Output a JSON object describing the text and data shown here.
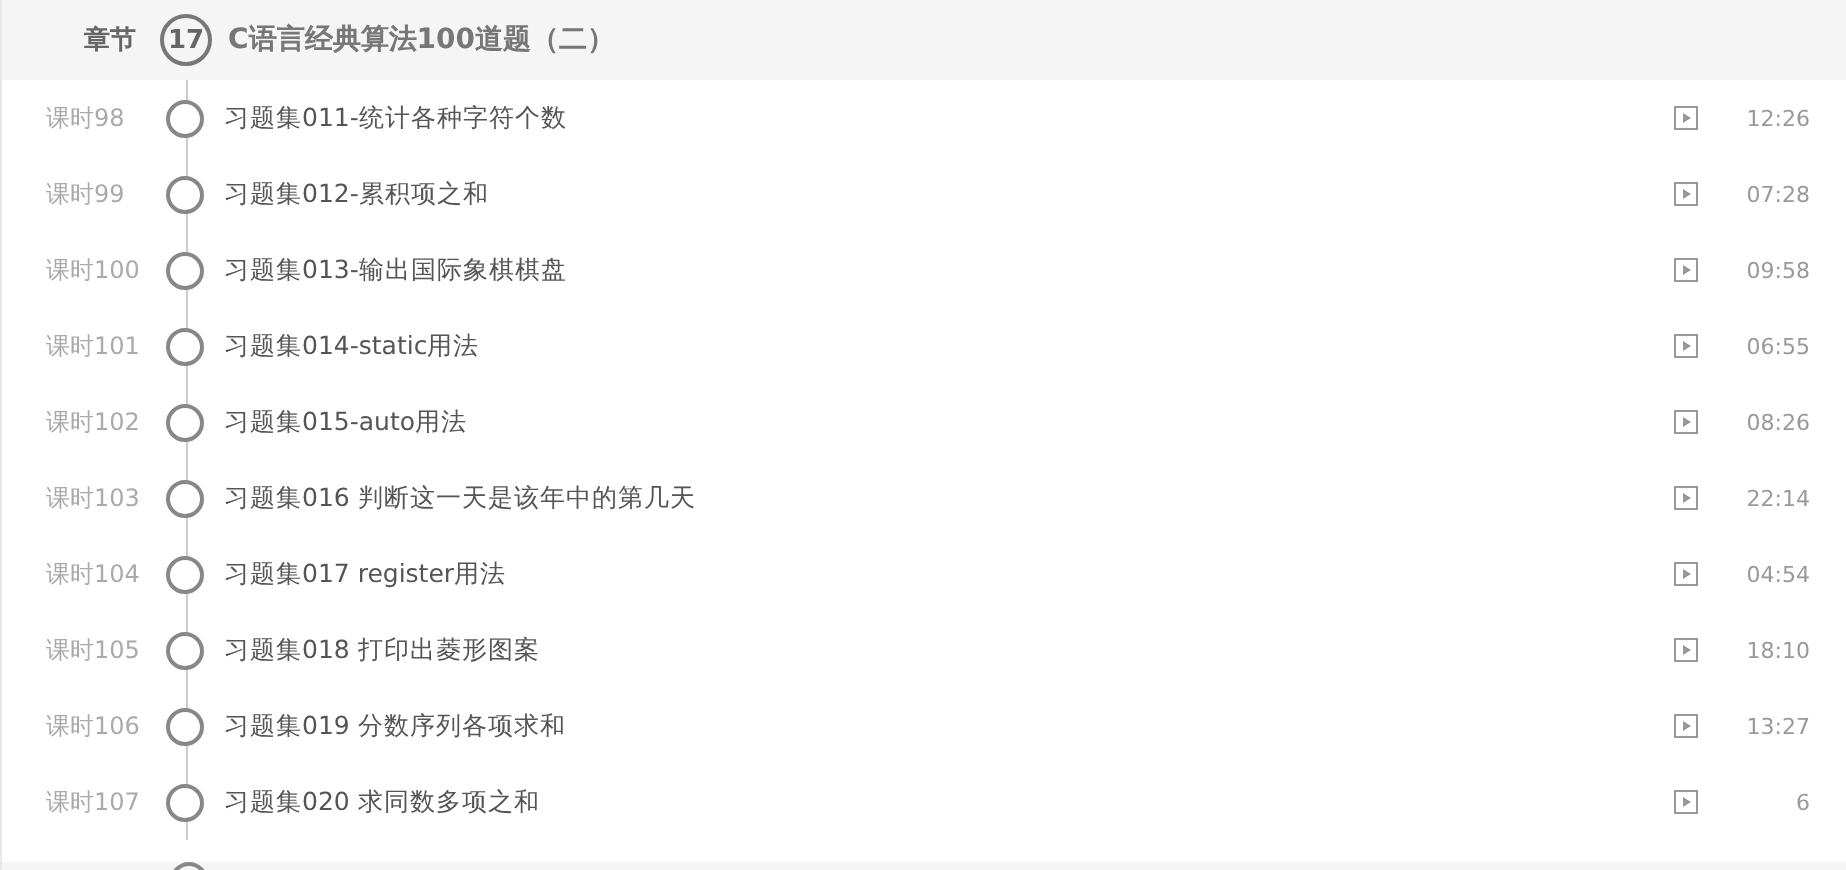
{
  "chapter": {
    "label": "章节",
    "number": "17",
    "title": "C语言经典算法100道题（二）"
  },
  "lessons": [
    {
      "label": "课时98",
      "title": "习题集011-统计各种字符个数",
      "duration": "12:26"
    },
    {
      "label": "课时99",
      "title": "习题集012-累积项之和",
      "duration": "07:28"
    },
    {
      "label": "课时100",
      "title": "习题集013-输出国际象棋棋盘",
      "duration": "09:58"
    },
    {
      "label": "课时101",
      "title": "习题集014-static用法",
      "duration": "06:55"
    },
    {
      "label": "课时102",
      "title": "习题集015-auto用法",
      "duration": "08:26"
    },
    {
      "label": "课时103",
      "title": "习题集016 判断这一天是该年中的第几天",
      "duration": "22:14"
    },
    {
      "label": "课时104",
      "title": "习题集017 register用法",
      "duration": "04:54"
    },
    {
      "label": "课时105",
      "title": "习题集018 打印出菱形图案",
      "duration": "18:10"
    },
    {
      "label": "课时106",
      "title": "习题集019 分数序列各项求和",
      "duration": "13:27"
    },
    {
      "label": "课时107",
      "title": "习题集020 求同数多项之和",
      "duration": "6"
    }
  ]
}
